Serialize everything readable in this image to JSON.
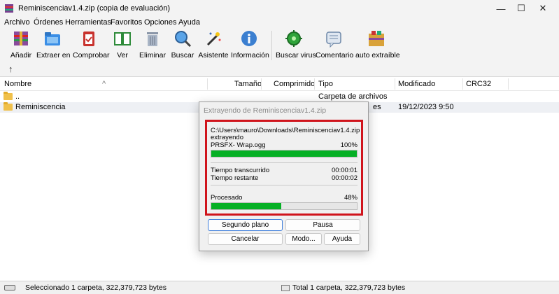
{
  "window": {
    "title": "Reminiscenciav1.4.zip (copia de evaluación)",
    "min_glyph": "—",
    "max_glyph": "☐",
    "close_glyph": "✕"
  },
  "menu": [
    "Archivo",
    "Órdenes",
    "Herramientas",
    "Favoritos",
    "Opciones",
    "Ayuda"
  ],
  "toolbar": {
    "items": [
      {
        "label": "Añadir",
        "icon": "winrar-add-icon"
      },
      {
        "label": "Extraer en",
        "icon": "extract-folder-icon"
      },
      {
        "label": "Comprobar",
        "icon": "test-clipboard-icon"
      },
      {
        "label": "Ver",
        "icon": "view-book-icon"
      },
      {
        "label": "Eliminar",
        "icon": "trash-icon"
      },
      {
        "label": "Buscar",
        "icon": "magnifier-icon"
      },
      {
        "label": "Asistente",
        "icon": "wizard-wand-icon"
      },
      {
        "label": "Información",
        "icon": "info-icon"
      },
      {
        "label": "Buscar virus",
        "icon": "virus-scan-icon"
      },
      {
        "label": "Comentario",
        "icon": "comment-icon"
      },
      {
        "label": "auto extraíble",
        "icon": "sfx-icon"
      }
    ],
    "up_glyph": "↑"
  },
  "columns": {
    "name": "Nombre",
    "size": "Tamaño",
    "packed": "Comprimido",
    "type": "Tipo",
    "modified": "Modificado",
    "crc": "CRC32",
    "sort_glyph": "^"
  },
  "files": [
    {
      "name": "..",
      "type": "Carpeta de archivos",
      "modified": ""
    },
    {
      "name": "Reminiscencia",
      "type": "es",
      "modified": "19/12/2023 9:50"
    }
  ],
  "status": {
    "left": "Seleccionado 1 carpeta, 322,379,723 bytes",
    "right": "Total 1 carpeta, 322,379,723 bytes"
  },
  "dialog": {
    "title": "Extrayendo de Reminiscenciav1.4.zip",
    "path": "C:\\Users\\mauro\\Downloads\\Reminiscenciav1.4.zip",
    "action": "extrayendo",
    "current_file": "PRSFX- Wrap.ogg",
    "file_percent_label": "100%",
    "file_progress": 1.0,
    "elapsed_label": "Tiempo transcurrido",
    "elapsed": "00:00:01",
    "remaining_label": "Tiempo restante",
    "remaining": "00:00:02",
    "processed_label": "Procesado",
    "processed_percent_label": "48%",
    "processed_progress": 0.48,
    "buttons": {
      "background": "Segundo plano",
      "pause": "Pausa",
      "cancel": "Cancelar",
      "mode": "Modo...",
      "help": "Ayuda"
    }
  },
  "colors": {
    "progress": "#06b025",
    "highlight_box": "#d0141c"
  }
}
